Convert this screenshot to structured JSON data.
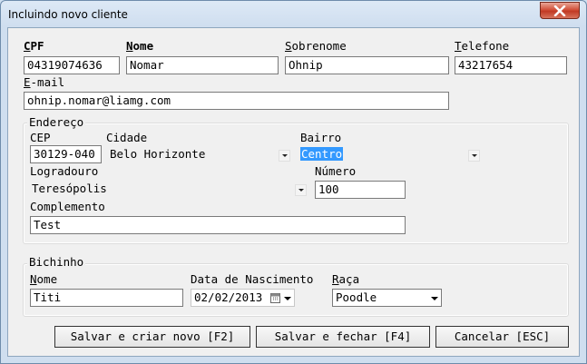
{
  "window": {
    "title": "Incluindo novo cliente"
  },
  "client": {
    "cpf": {
      "label_u": "C",
      "label_rest": "PF",
      "value": "04319074636"
    },
    "nome": {
      "label_u": "N",
      "label_rest": "ome",
      "value": "Nomar"
    },
    "sobrenome": {
      "label_u": "S",
      "label_rest": "obrenome",
      "value": "Ohnip"
    },
    "telefone": {
      "label_u": "T",
      "label_rest": "elefone",
      "value": "43217654"
    },
    "email": {
      "label_u": "E",
      "label_rest": "-mail",
      "value": "ohnip.nomar@liamg.com"
    }
  },
  "endereco": {
    "legend": "Endereço",
    "cep": {
      "label": "CEP",
      "value": "30129-040"
    },
    "cidade": {
      "label": "Cidade",
      "value": "Belo Horizonte"
    },
    "bairro": {
      "label": "Bairro",
      "value": "Centro"
    },
    "logradouro": {
      "label": "Logradouro",
      "value": "Teresópolis"
    },
    "numero": {
      "label": "Número",
      "value": "100"
    },
    "complemento": {
      "label": "Complemento",
      "value": "Test"
    }
  },
  "bichinho": {
    "legend": "Bichinho",
    "nome": {
      "label_u": "N",
      "label_rest": "ome",
      "value": "Titi"
    },
    "nascimento": {
      "label": "Data de Nascimento",
      "value": "02/02/2013"
    },
    "raca": {
      "label_u": "R",
      "label_rest": "aça",
      "value": "Poodle"
    }
  },
  "buttons": {
    "save_new": "Salvar e criar novo [F2]",
    "save_close": "Salvar e fechar [F4]",
    "cancel": "Cancelar [ESC]"
  }
}
